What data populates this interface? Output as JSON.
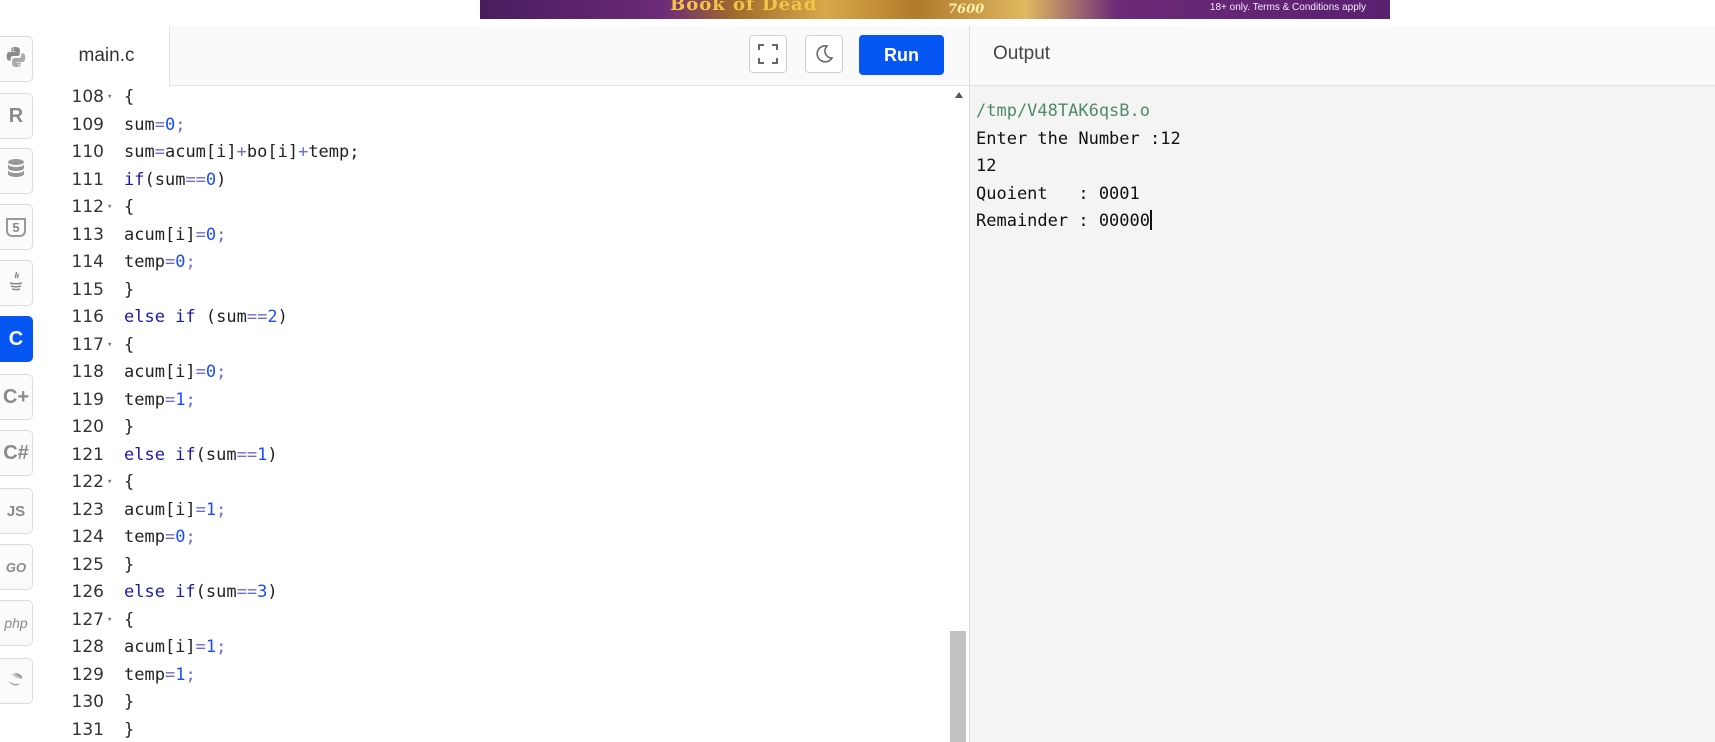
{
  "ad": {
    "title": "Book of Dead",
    "amount": "7600",
    "terms": "18+ only. Terms & Conditions apply"
  },
  "sidebar": {
    "languages": [
      {
        "name": "python-icon",
        "label": ""
      },
      {
        "name": "r-icon",
        "label": "R"
      },
      {
        "name": "database-icon",
        "label": ""
      },
      {
        "name": "html5-icon",
        "label": "5"
      },
      {
        "name": "java-icon",
        "label": ""
      },
      {
        "name": "c-icon",
        "label": "C",
        "active": true
      },
      {
        "name": "cpp-icon",
        "label": "C+"
      },
      {
        "name": "csharp-icon",
        "label": "C#"
      },
      {
        "name": "js-icon",
        "label": "JS"
      },
      {
        "name": "go-icon",
        "label": "GO"
      },
      {
        "name": "php-icon",
        "label": "php"
      },
      {
        "name": "swift-icon",
        "label": ""
      }
    ]
  },
  "editor": {
    "file_tab": "main.c",
    "run_label": "Run",
    "lines": [
      {
        "n": "108",
        "fold": true,
        "tokens": [
          [
            "p",
            "{"
          ]
        ]
      },
      {
        "n": "109",
        "tokens": [
          [
            "p",
            "sum"
          ],
          [
            "o",
            "="
          ],
          [
            "n",
            "0"
          ],
          [
            "o",
            ";"
          ]
        ]
      },
      {
        "n": "110",
        "tokens": [
          [
            "p",
            "sum"
          ],
          [
            "o",
            "="
          ],
          [
            "p",
            "acum[i]"
          ],
          [
            "o",
            "+"
          ],
          [
            "p",
            "bo[i]"
          ],
          [
            "o",
            "+"
          ],
          [
            "p",
            "temp;"
          ]
        ]
      },
      {
        "n": "111",
        "tokens": [
          [
            "k",
            "if"
          ],
          [
            "p",
            "(sum"
          ],
          [
            "o",
            "=="
          ],
          [
            "n",
            "0"
          ],
          [
            "p",
            ")"
          ]
        ]
      },
      {
        "n": "112",
        "fold": true,
        "tokens": [
          [
            "p",
            "{"
          ]
        ]
      },
      {
        "n": "113",
        "tokens": [
          [
            "p",
            "acum[i]"
          ],
          [
            "o",
            "="
          ],
          [
            "n",
            "0"
          ],
          [
            "o",
            ";"
          ]
        ]
      },
      {
        "n": "114",
        "tokens": [
          [
            "p",
            "temp"
          ],
          [
            "o",
            "="
          ],
          [
            "n",
            "0"
          ],
          [
            "o",
            ";"
          ]
        ]
      },
      {
        "n": "115",
        "tokens": [
          [
            "p",
            "}"
          ]
        ]
      },
      {
        "n": "116",
        "tokens": [
          [
            "k",
            "else if"
          ],
          [
            "p",
            " (sum"
          ],
          [
            "o",
            "=="
          ],
          [
            "n",
            "2"
          ],
          [
            "p",
            ")"
          ]
        ]
      },
      {
        "n": "117",
        "fold": true,
        "tokens": [
          [
            "p",
            "{"
          ]
        ]
      },
      {
        "n": "118",
        "tokens": [
          [
            "p",
            "acum[i]"
          ],
          [
            "o",
            "="
          ],
          [
            "n",
            "0"
          ],
          [
            "o",
            ";"
          ]
        ]
      },
      {
        "n": "119",
        "tokens": [
          [
            "p",
            "temp"
          ],
          [
            "o",
            "="
          ],
          [
            "n",
            "1"
          ],
          [
            "o",
            ";"
          ]
        ]
      },
      {
        "n": "120",
        "tokens": [
          [
            "p",
            "}"
          ]
        ]
      },
      {
        "n": "121",
        "tokens": [
          [
            "k",
            "else if"
          ],
          [
            "p",
            "(sum"
          ],
          [
            "o",
            "=="
          ],
          [
            "n",
            "1"
          ],
          [
            "p",
            ")"
          ]
        ]
      },
      {
        "n": "122",
        "fold": true,
        "tokens": [
          [
            "p",
            "{"
          ]
        ]
      },
      {
        "n": "123",
        "tokens": [
          [
            "p",
            "acum[i]"
          ],
          [
            "o",
            "="
          ],
          [
            "n",
            "1"
          ],
          [
            "o",
            ";"
          ]
        ]
      },
      {
        "n": "124",
        "tokens": [
          [
            "p",
            "temp"
          ],
          [
            "o",
            "="
          ],
          [
            "n",
            "0"
          ],
          [
            "o",
            ";"
          ]
        ]
      },
      {
        "n": "125",
        "tokens": [
          [
            "p",
            "}"
          ]
        ]
      },
      {
        "n": "126",
        "tokens": [
          [
            "k",
            "else if"
          ],
          [
            "p",
            "(sum"
          ],
          [
            "o",
            "=="
          ],
          [
            "n",
            "3"
          ],
          [
            "p",
            ")"
          ]
        ]
      },
      {
        "n": "127",
        "fold": true,
        "tokens": [
          [
            "p",
            "{"
          ]
        ]
      },
      {
        "n": "128",
        "tokens": [
          [
            "p",
            "acum[i]"
          ],
          [
            "o",
            "="
          ],
          [
            "n",
            "1"
          ],
          [
            "o",
            ";"
          ]
        ]
      },
      {
        "n": "129",
        "tokens": [
          [
            "p",
            "temp"
          ],
          [
            "o",
            "="
          ],
          [
            "n",
            "1"
          ],
          [
            "o",
            ";"
          ]
        ]
      },
      {
        "n": "130",
        "tokens": [
          [
            "p",
            "}"
          ]
        ]
      },
      {
        "n": "131",
        "tokens": [
          [
            "p",
            "}"
          ]
        ]
      }
    ]
  },
  "output": {
    "title": "Output",
    "path": "/tmp/V48TAK6qsB.o",
    "lines": [
      "Enter the Number :12",
      "12",
      "Quoient   : 0001",
      "Remainder : 00000"
    ]
  },
  "colors": {
    "accent": "#0556f3",
    "keyword": "#1a1ab0",
    "number": "#1a4cff",
    "operator": "#6b6bd6",
    "output_path": "#4f8a6a"
  }
}
